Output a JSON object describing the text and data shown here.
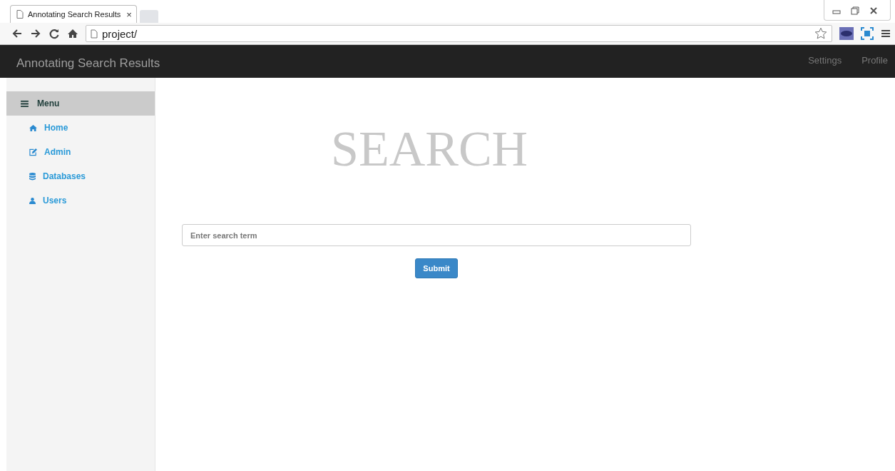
{
  "browser": {
    "tab_title": "Annotating Search Results",
    "tab_close": "×",
    "address": "project/"
  },
  "navbar": {
    "brand": "Annotating Search Results",
    "links": [
      "Settings",
      "Profile"
    ]
  },
  "sidebar": {
    "header": "Menu",
    "items": [
      {
        "label": "Home"
      },
      {
        "label": "Admin"
      },
      {
        "label": "Databases"
      },
      {
        "label": "Users"
      }
    ]
  },
  "main": {
    "heading": "SEARCH",
    "search": {
      "placeholder": "Enter search term"
    },
    "submit": "Submit"
  }
}
